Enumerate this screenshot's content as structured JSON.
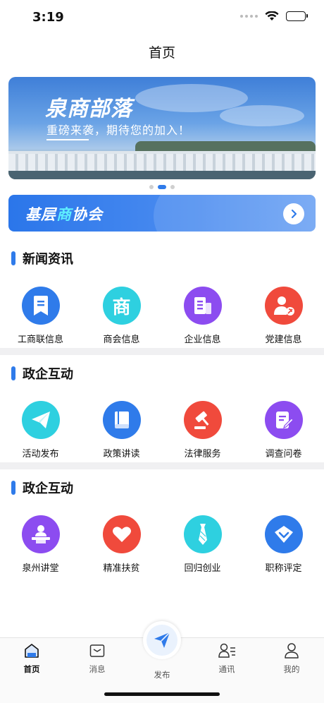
{
  "status_bar": {
    "time": "3:19"
  },
  "nav": {
    "title": "首页"
  },
  "banner": {
    "title": "泉商部落",
    "subtitle": "重磅来袭，期待您的加入！"
  },
  "association": {
    "prefix": "基层",
    "highlight": "商",
    "suffix": "协会"
  },
  "sections": [
    {
      "title": "新闻资讯",
      "items": [
        {
          "label": "工商联信息",
          "icon": "bookmark-doc-icon",
          "color": "#2f7bea"
        },
        {
          "label": "商会信息",
          "icon": "shang-character-icon",
          "color": "#2ed0e0"
        },
        {
          "label": "企业信息",
          "icon": "building-doc-icon",
          "color": "#8c4cf0"
        },
        {
          "label": "党建信息",
          "icon": "party-member-icon",
          "color": "#f04a3c"
        }
      ]
    },
    {
      "title": "政企互动",
      "items": [
        {
          "label": "活动发布",
          "icon": "paper-plane-icon",
          "color": "#2ed0e0"
        },
        {
          "label": "政策讲读",
          "icon": "book-icon",
          "color": "#2f7bea"
        },
        {
          "label": "法律服务",
          "icon": "gavel-icon",
          "color": "#f04a3c"
        },
        {
          "label": "调查问卷",
          "icon": "survey-edit-icon",
          "color": "#8c4cf0"
        }
      ]
    },
    {
      "title": "政企互动",
      "items": [
        {
          "label": "泉州讲堂",
          "icon": "lecturer-podium-icon",
          "color": "#8c4cf0"
        },
        {
          "label": "精准扶贫",
          "icon": "heart-icon",
          "color": "#f04a3c"
        },
        {
          "label": "回归创业",
          "icon": "necktie-icon",
          "color": "#2ed0e0"
        },
        {
          "label": "职称评定",
          "icon": "diamond-badge-icon",
          "color": "#2f7bea"
        }
      ]
    }
  ],
  "tabbar": {
    "items": [
      {
        "label": "首页",
        "icon": "home-icon",
        "active": true
      },
      {
        "label": "消息",
        "icon": "message-icon",
        "active": false
      },
      {
        "label": "发布",
        "icon": "send-icon",
        "active": false
      },
      {
        "label": "通讯",
        "icon": "contacts-icon",
        "active": false
      },
      {
        "label": "我的",
        "icon": "profile-icon",
        "active": false
      }
    ]
  }
}
